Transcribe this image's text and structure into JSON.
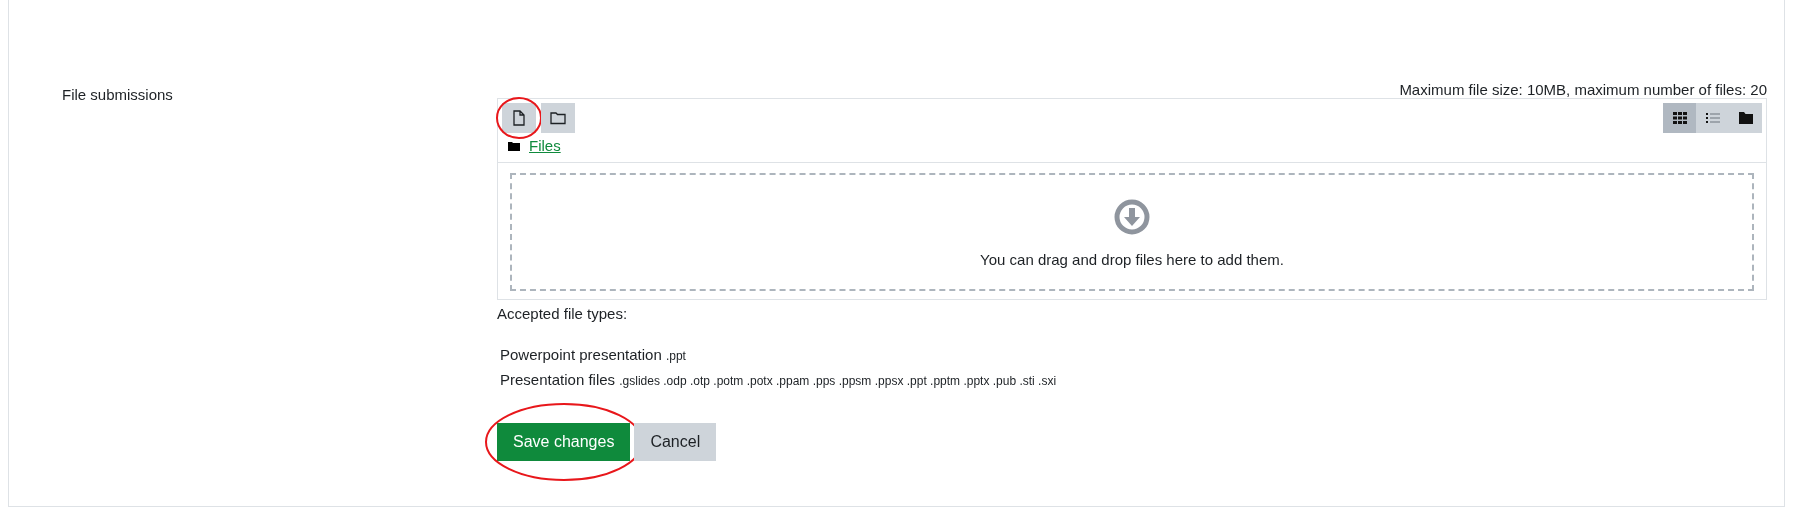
{
  "field_label": "File submissions",
  "limits": "Maximum file size: 10MB, maximum number of files: 20",
  "toolbar": [
    {
      "kind": "add-file",
      "circled": true
    },
    {
      "kind": "create-folder",
      "circled": false
    }
  ],
  "view_modes": [
    {
      "kind": "grid",
      "selected": true
    },
    {
      "kind": "list",
      "selected": false
    },
    {
      "kind": "tree",
      "selected": false
    }
  ],
  "path": {
    "label": "Files"
  },
  "dropzone": {
    "message": "You can drag and drop files here to add them."
  },
  "accepted": {
    "heading": "Accepted file types:",
    "types": [
      {
        "name": "Powerpoint presentation",
        "extensions": ".ppt"
      },
      {
        "name": "Presentation files",
        "extensions": ".gslides .odp .otp .potm .potx .ppam .pps .ppsm .ppsx .ppt .pptm .pptx .pub .sti .sxi"
      }
    ]
  },
  "buttons": [
    {
      "label": "Save changes",
      "kind": "primary",
      "circled": true
    },
    {
      "label": "Cancel",
      "kind": "secondary",
      "circled": false
    }
  ]
}
